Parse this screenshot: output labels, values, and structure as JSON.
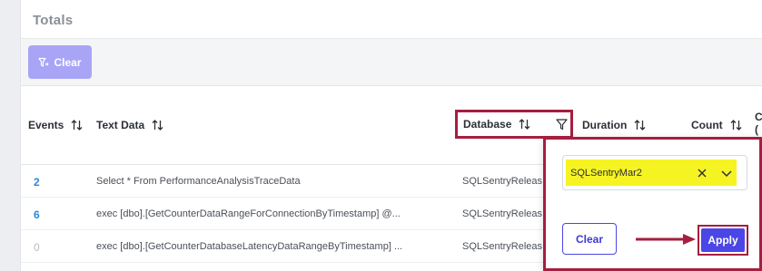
{
  "panel": {
    "title": "Totals"
  },
  "toolbar": {
    "clear_label": "Clear"
  },
  "columns": {
    "events": "Events",
    "text_data": "Text Data",
    "database": "Database",
    "duration": "Duration",
    "count": "Count",
    "cutoff_line1": "C",
    "cutoff_line2": "("
  },
  "rows": [
    {
      "events": "2",
      "text_data": "Select * From PerformanceAnalysisTraceData",
      "database": "SQLSentryReleas"
    },
    {
      "events": "6",
      "text_data": "exec [dbo].[GetCounterDataRangeForConnectionByTimestamp] @...",
      "database": "SQLSentryReleas"
    },
    {
      "events": "0",
      "text_data": "exec [dbo].[GetCounterDatabaseLatencyDataRangeByTimestamp] ...",
      "database": "SQLSentryReleas"
    }
  ],
  "filter_popup": {
    "selected_value": "SQLSentryMar2",
    "clear_label": "Clear",
    "apply_label": "Apply"
  },
  "colors": {
    "accent": "#4b46e5",
    "highlight": "#f6f322",
    "annotation": "#a61e40",
    "link": "#2e86d6"
  }
}
